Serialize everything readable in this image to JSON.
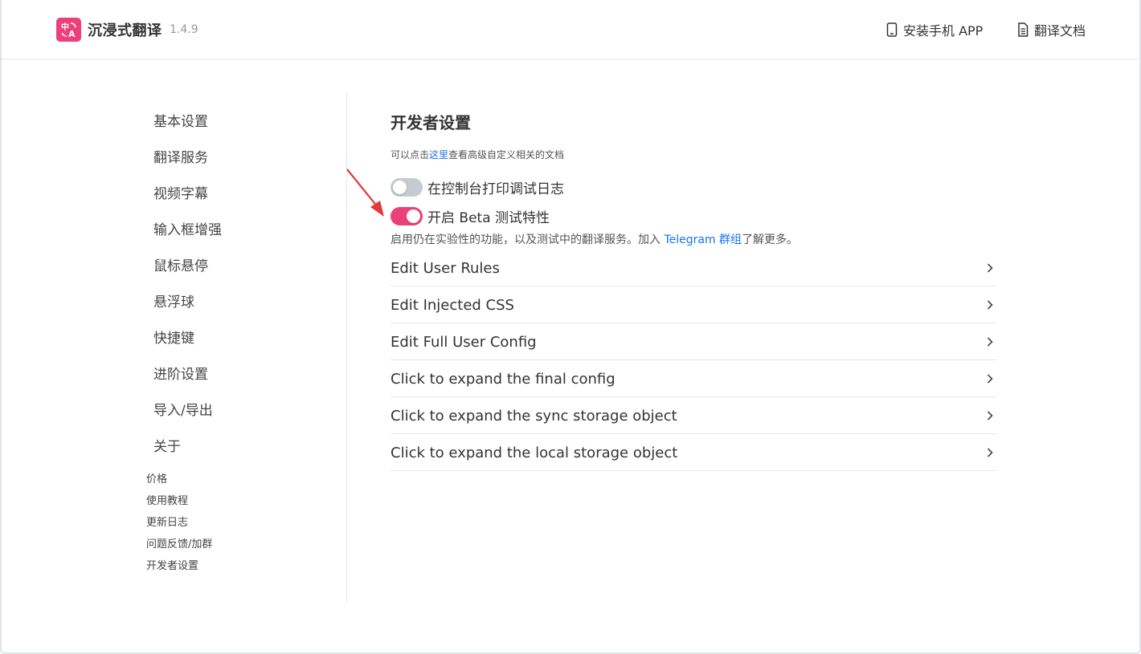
{
  "header": {
    "app_name": "沉浸式翻译",
    "version": "1.4.9",
    "install_app_label": "安装手机 APP",
    "docs_label": "翻译文档",
    "logo_text": "中A"
  },
  "sidebar": {
    "items": [
      {
        "label": "基本设置"
      },
      {
        "label": "翻译服务"
      },
      {
        "label": "视频字幕"
      },
      {
        "label": "输入框增强"
      },
      {
        "label": "鼠标悬停"
      },
      {
        "label": "悬浮球"
      },
      {
        "label": "快捷键"
      },
      {
        "label": "进阶设置"
      },
      {
        "label": "导入/导出"
      },
      {
        "label": "关于"
      }
    ],
    "small_items": [
      {
        "label": "价格"
      },
      {
        "label": "使用教程"
      },
      {
        "label": "更新日志"
      },
      {
        "label": "问题反馈/加群"
      },
      {
        "label": "开发者设置"
      }
    ]
  },
  "main": {
    "title": "开发者设置",
    "hint_prefix": "可以点击",
    "hint_link": "这里",
    "hint_suffix": "查看高级自定义相关的文档",
    "toggle_debug": {
      "label": "在控制台打印调试日志",
      "on": false
    },
    "toggle_beta": {
      "label": "开启 Beta 测试特性",
      "on": true
    },
    "beta_desc_prefix": "启用仍在实验性的功能，以及测试中的翻译服务。加入 ",
    "beta_desc_link": "Telegram 群组",
    "beta_desc_suffix": "了解更多。",
    "list": [
      {
        "label": "Edit User Rules"
      },
      {
        "label": "Edit Injected CSS"
      },
      {
        "label": "Edit Full User Config"
      },
      {
        "label": "Click to expand the final config"
      },
      {
        "label": "Click to expand the sync storage object"
      },
      {
        "label": "Click to expand the local storage object"
      }
    ]
  },
  "colors": {
    "accent": "#ec407a",
    "link": "#1a73e8",
    "toggle_off": "#c6cbd1",
    "annotation_arrow": "#e53935"
  }
}
